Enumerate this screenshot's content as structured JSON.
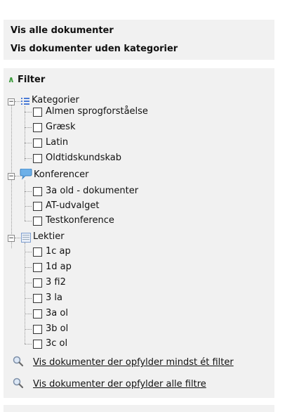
{
  "links": {
    "show_all": "Vis alle dokumenter",
    "show_no_category": "Vis dokumenter uden kategorier"
  },
  "filter": {
    "title": "Filter",
    "groups": [
      {
        "label": "Kategorier",
        "icon": "list-icon",
        "items": [
          "Almen sprogforståelse",
          "Græsk",
          "Latin",
          "Oldtidskundskab"
        ]
      },
      {
        "label": "Konferencer",
        "icon": "speech-bubble-icon",
        "items": [
          "3a old - dokumenter",
          "AT-udvalget",
          "Testkonference"
        ]
      },
      {
        "label": "Lektier",
        "icon": "document-icon",
        "items": [
          "1c ap",
          "1d ap",
          "3 fi2",
          "3 la",
          "3a ol",
          "3b ol",
          "3c ol"
        ]
      }
    ]
  },
  "actions": {
    "any_filter": "Vis dokumenter der opfylder mindst ét filter",
    "all_filters": "Vis dokumenter der opfylder alle filtre"
  },
  "colors": {
    "panel_bg": "#f1f1f1",
    "chevron": "#3a9a3a"
  }
}
